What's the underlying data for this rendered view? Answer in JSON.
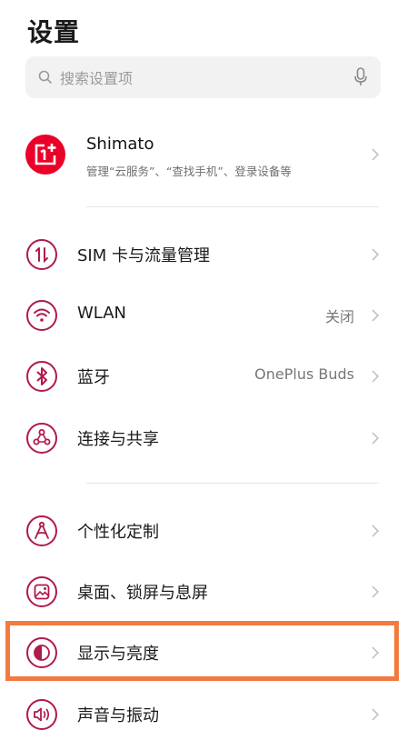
{
  "header": {
    "title": "设置"
  },
  "search": {
    "placeholder": "搜索设置项"
  },
  "account": {
    "name": "Shimato",
    "subtitle": "管理“云服务”、“查找手机”、登录设备等"
  },
  "settings": {
    "sim": {
      "label": "SIM 卡与流量管理"
    },
    "wlan": {
      "label": "WLAN",
      "value": "关闭"
    },
    "bluetooth": {
      "label": "蓝牙",
      "value": "OnePlus Buds"
    },
    "connection": {
      "label": "连接与共享"
    },
    "personalize": {
      "label": "个性化定制"
    },
    "desktop": {
      "label": "桌面、锁屏与息屏"
    },
    "display": {
      "label": "显示与亮度"
    },
    "sound": {
      "label": "声音与振动"
    }
  },
  "colors": {
    "accent": "#b0194e",
    "brand": "#eb0029",
    "highlight": "#f27a40"
  },
  "icons": [
    "search-icon",
    "microphone-icon",
    "oneplus-logo-icon",
    "sim-icon",
    "wifi-icon",
    "bluetooth-icon",
    "share-icon",
    "personalize-icon",
    "wallpaper-icon",
    "display-icon",
    "sound-icon",
    "chevron-right-icon"
  ]
}
